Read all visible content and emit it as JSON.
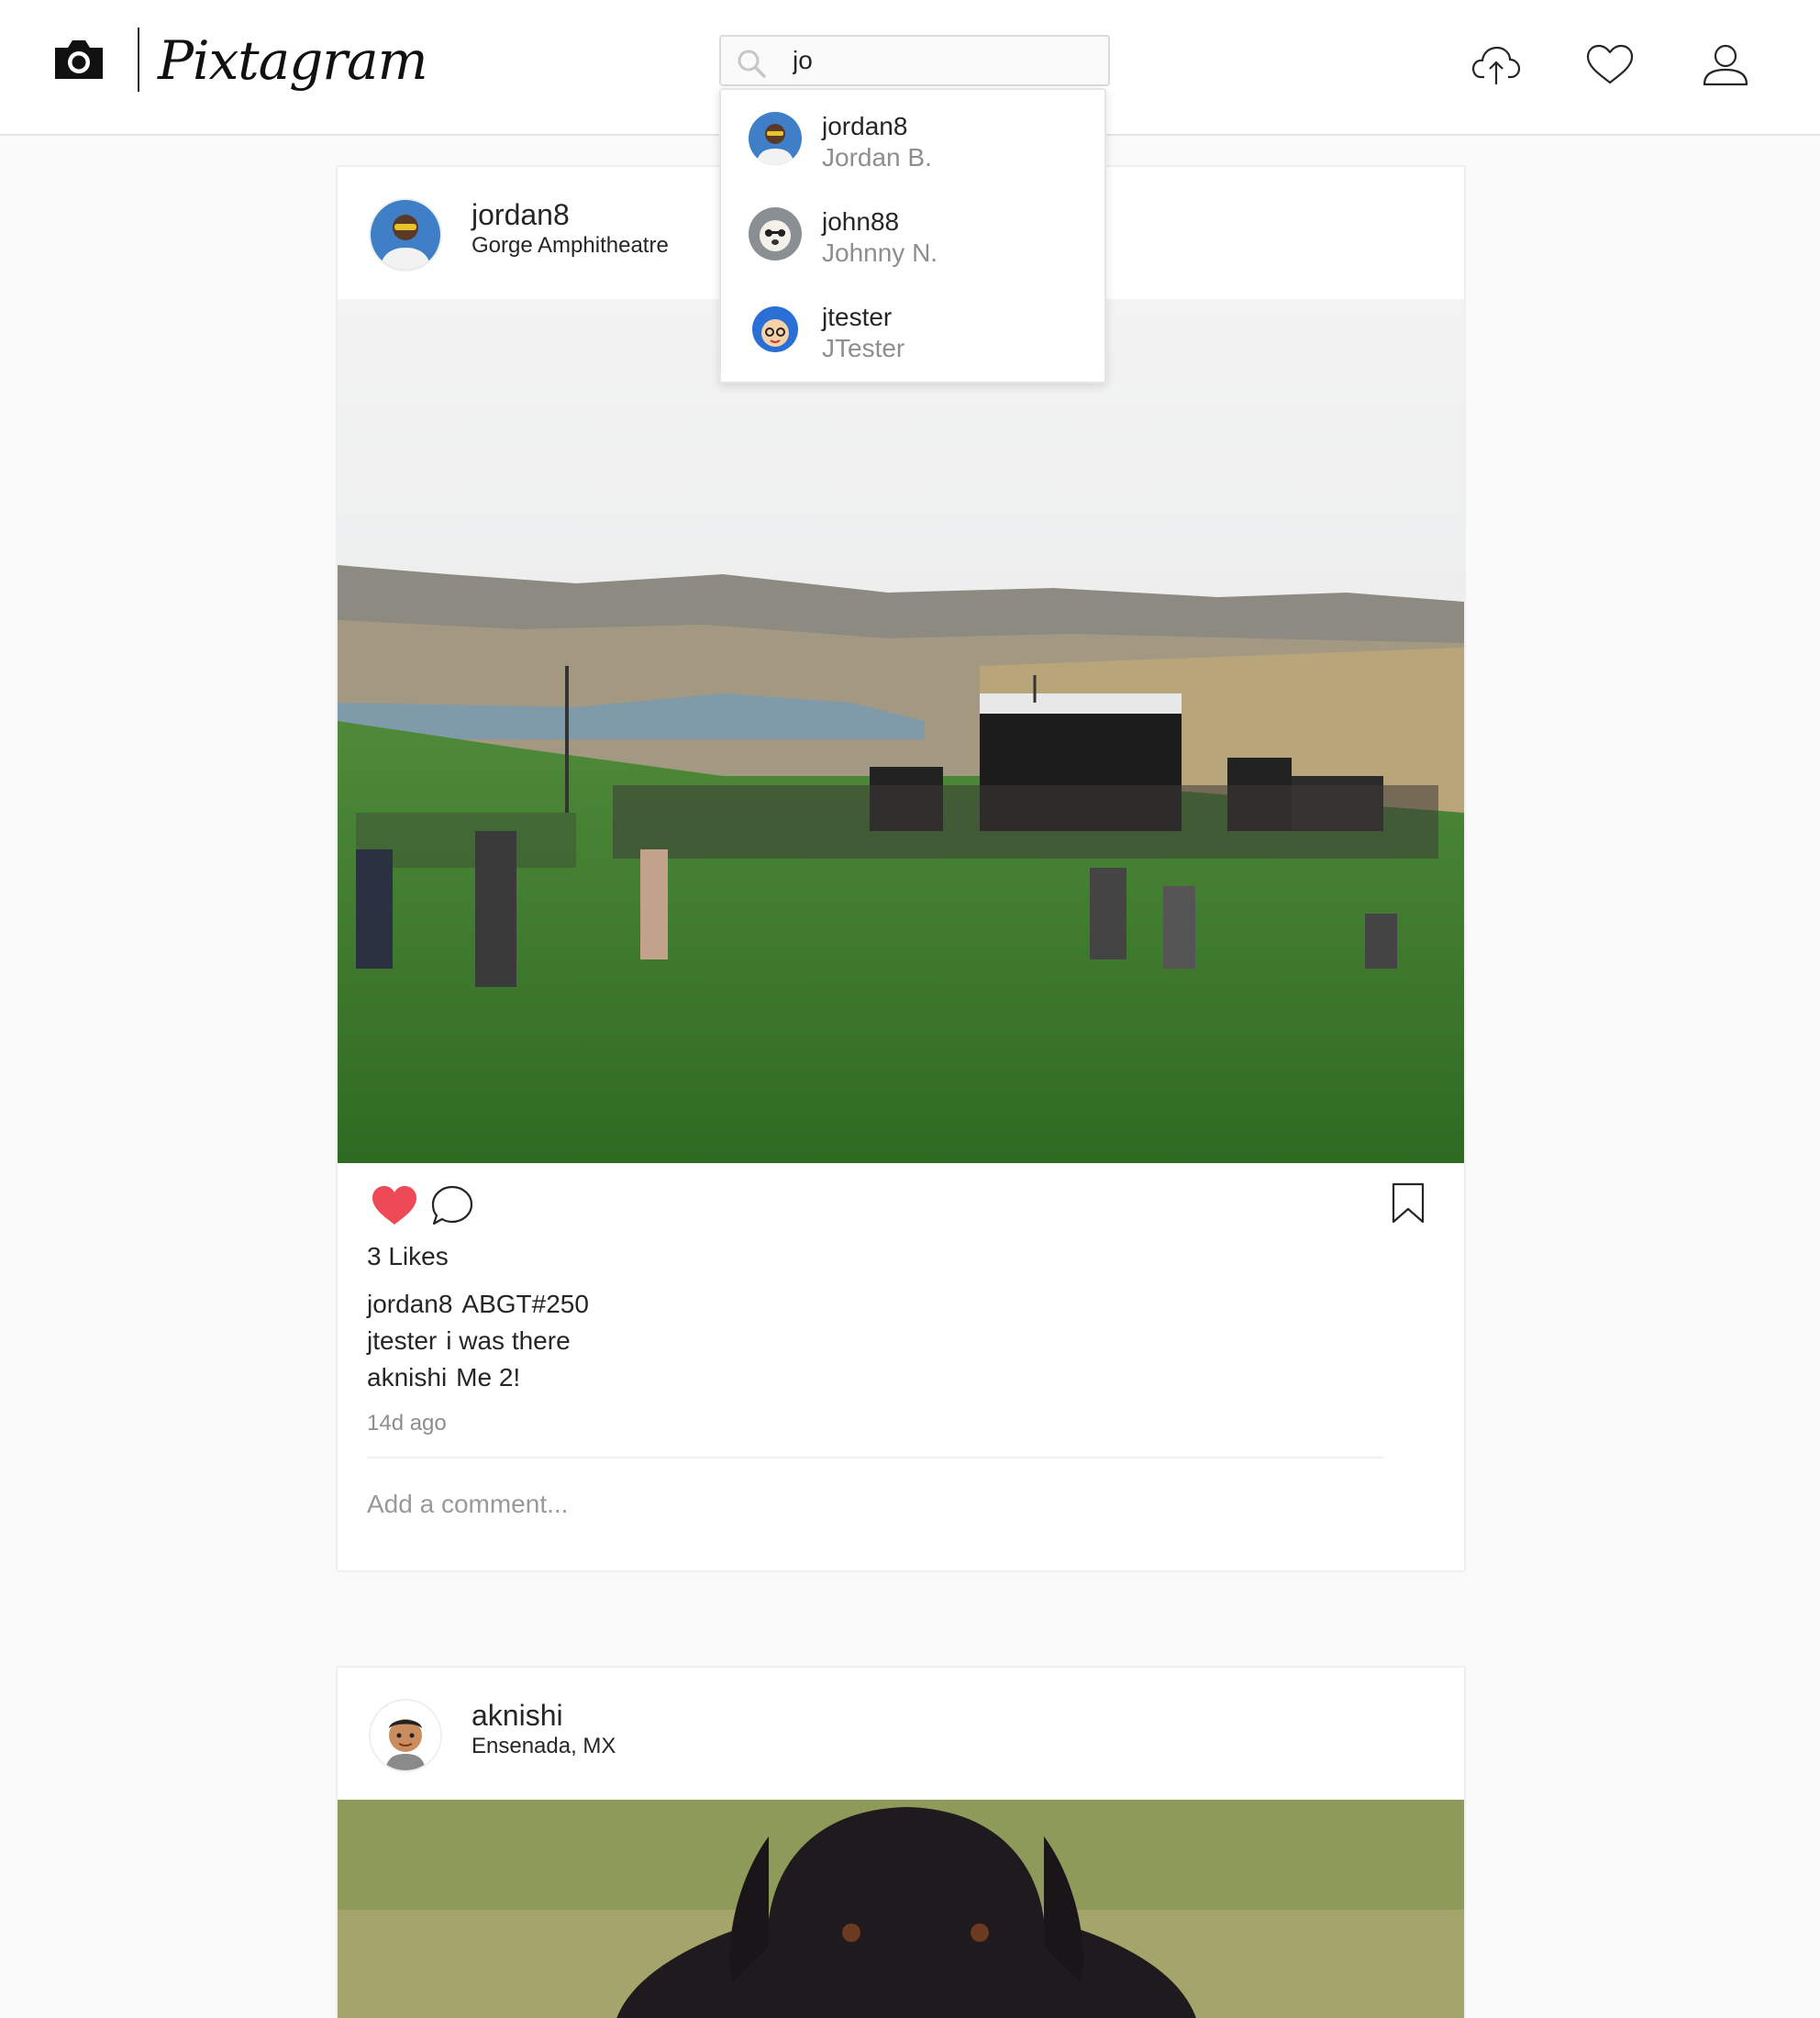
{
  "app": {
    "logo_text": "Pixtagram"
  },
  "header": {
    "search": {
      "value": "jo",
      "placeholder": "Search"
    },
    "icons": [
      "camera-icon",
      "upload-cloud-icon",
      "heart-icon",
      "user-profile-icon"
    ]
  },
  "search_results": [
    {
      "username": "jordan8",
      "name": "Jordan B."
    },
    {
      "username": "john88",
      "name": "Johnny N."
    },
    {
      "username": "jtester",
      "name": "JTester"
    }
  ],
  "posts": [
    {
      "username": "jordan8",
      "location": "Gorge Amphitheatre",
      "likes_text": "3 Likes",
      "liked": true,
      "comments": [
        {
          "user": "jordan8",
          "text": "ABGT#250"
        },
        {
          "user": "jtester",
          "text": "i was there"
        },
        {
          "user": "aknishi",
          "text": "Me 2!"
        }
      ],
      "timestamp": "14d ago",
      "add_comment_placeholder": "Add a comment..."
    },
    {
      "username": "aknishi",
      "location": "Ensenada, MX"
    }
  ],
  "colors": {
    "like_red": "#ed4956",
    "border": "#efefef",
    "muted_text": "#8e8e8e",
    "background": "#fafafa"
  }
}
